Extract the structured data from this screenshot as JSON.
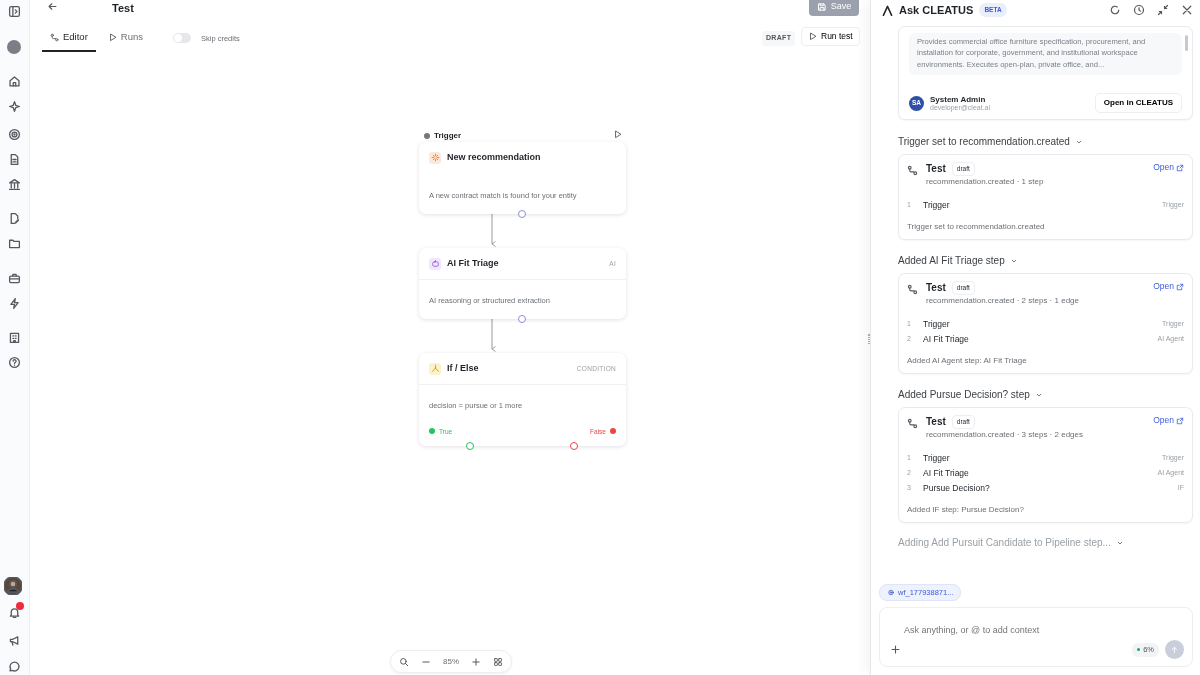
{
  "sidebar": {
    "unread_notifications": true
  },
  "header": {
    "title": "Test",
    "save_button": {
      "label": "Save",
      "disabled": true
    },
    "status": "DRAFT",
    "run_button": "Run test"
  },
  "tabs": [
    {
      "label": "Editor",
      "selected": true
    },
    {
      "label": "Runs",
      "selected": false
    }
  ],
  "skip_credits": {
    "label": "Skip credits",
    "on": false
  },
  "nodes": [
    {
      "kind": "trigger",
      "group_label": "Trigger",
      "title": "New recommendation",
      "description": "A new contract match is found for your entity"
    },
    {
      "kind": "ai",
      "title": "AI Fit Triage",
      "tag": "AI",
      "description": "AI reasoning or structured extraction"
    },
    {
      "kind": "condition",
      "title": "If / Else",
      "tag": "CONDITION",
      "description": "decision = pursue or 1 more",
      "branches": [
        {
          "label": "True",
          "color": "#22c55e"
        },
        {
          "label": "False",
          "color": "#ef4444"
        }
      ]
    }
  ],
  "zoom_level": "85%",
  "panel": {
    "title": "Ask CLEATUS",
    "badge": "BETA",
    "result": {
      "description": "Provides commercial office furniture specification, procurement, and installation for corporate, government, and institutional workspace environments. Executes open-plan, private office, and...",
      "initials": "SA",
      "user_name": "System Admin",
      "user_email": "developer@cleat.ai",
      "button": "Open in CLEATUS"
    },
    "steps": [
      {
        "heading": "Trigger set to recommendation.created",
        "card": {
          "name": "Test",
          "status": "draft",
          "link": "Open",
          "meta": "recommendation.created · 1 step",
          "items": [
            {
              "number": "1",
              "name": "Trigger",
              "type": "Trigger"
            }
          ],
          "note": "Trigger set to recommendation.created"
        }
      },
      {
        "heading": "Added AI Fit Triage step",
        "card": {
          "name": "Test",
          "status": "draft",
          "link": "Open",
          "meta": "recommendation.created · 2 steps · 1 edge",
          "items": [
            {
              "number": "1",
              "name": "Trigger",
              "type": "Trigger"
            },
            {
              "number": "2",
              "name": "AI Fit Triage",
              "type": "AI Agent"
            }
          ],
          "note": "Added AI Agent step: AI Fit Triage"
        }
      },
      {
        "heading": "Added Pursue Decision? step",
        "card": {
          "name": "Test",
          "status": "draft",
          "link": "Open",
          "meta": "recommendation.created · 3 steps · 2 edges",
          "items": [
            {
              "number": "1",
              "name": "Trigger",
              "type": "Trigger"
            },
            {
              "number": "2",
              "name": "AI Fit Triage",
              "type": "AI Agent"
            },
            {
              "number": "3",
              "name": "Pursue Decision?",
              "type": "IF"
            }
          ],
          "note": "Added IF step: Pursue Decision?"
        }
      }
    ],
    "pending": "Adding Add Pursuit Candidate to Pipeline step...",
    "context_chip": "wf_177938871...",
    "input": {
      "placeholder": "Ask anything, or @ to add context"
    },
    "usage": "6%"
  }
}
